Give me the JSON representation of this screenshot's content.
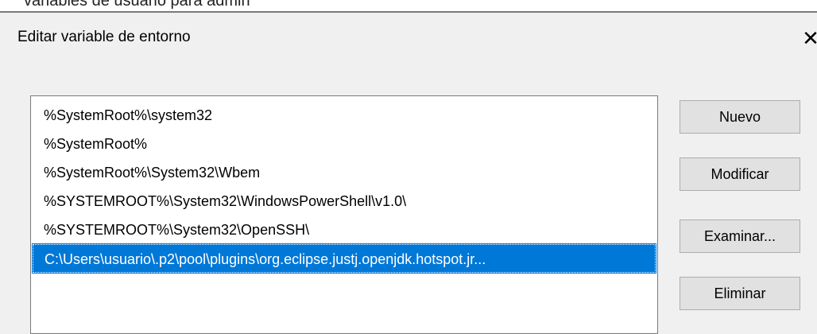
{
  "background_window": {
    "partial_text": "variables de usuario para admin"
  },
  "dialog": {
    "title": "Editar variable de entorno",
    "close_glyph": "✕"
  },
  "path_list": {
    "items": [
      "%SystemRoot%\\system32",
      "%SystemRoot%",
      "%SystemRoot%\\System32\\Wbem",
      "%SYSTEMROOT%\\System32\\WindowsPowerShell\\v1.0\\",
      "%SYSTEMROOT%\\System32\\OpenSSH\\",
      "C:\\Users\\usuario\\.p2\\pool\\plugins\\org.eclipse.justj.openjdk.hotspot.jr..."
    ],
    "selected_index": 5
  },
  "buttons": {
    "new_label": "Nuevo",
    "edit_label": "Modificar",
    "browse_label": "Examinar...",
    "delete_label": "Eliminar"
  },
  "colors": {
    "selection": "#0078d7",
    "dialog_bg": "#f0f0f0",
    "button_bg": "#e1e1e1"
  }
}
